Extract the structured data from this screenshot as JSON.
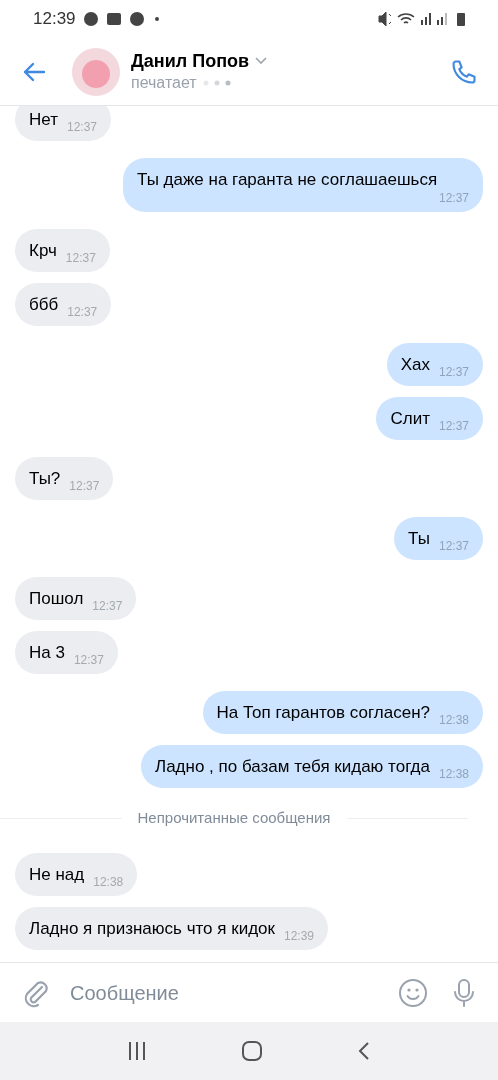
{
  "status_bar": {
    "time": "12:39"
  },
  "header": {
    "name": "Данил Попов",
    "status": "печатает"
  },
  "messages": [
    {
      "kind": "incoming",
      "text": "Нет",
      "time": "12:37"
    },
    {
      "kind": "outgoing",
      "text": "Ты даже на гаранта не соглашаешься",
      "time": "12:37"
    },
    {
      "kind": "incoming",
      "text": "Крч",
      "time": "12:37"
    },
    {
      "kind": "incoming",
      "text": "ббб",
      "time": "12:37"
    },
    {
      "kind": "outgoing",
      "text": "Хах",
      "time": "12:37"
    },
    {
      "kind": "outgoing",
      "text": "Слит",
      "time": "12:37"
    },
    {
      "kind": "incoming",
      "text": "Ты?",
      "time": "12:37"
    },
    {
      "kind": "outgoing",
      "text": "Ты",
      "time": "12:37"
    },
    {
      "kind": "incoming",
      "text": "Пошол",
      "time": "12:37"
    },
    {
      "kind": "incoming",
      "text": "На 3",
      "time": "12:37"
    },
    {
      "kind": "outgoing",
      "text": "На Топ гарантов согласен?",
      "time": "12:38"
    },
    {
      "kind": "outgoing",
      "text": "Ладно , по базам тебя кидаю тогда",
      "time": "12:38"
    },
    {
      "kind": "separator",
      "text": "Непрочитанные сообщения"
    },
    {
      "kind": "incoming",
      "text": "Не над",
      "time": "12:38"
    },
    {
      "kind": "incoming",
      "text": "Ладно я признаюсь что я кидок",
      "time": "12:39"
    }
  ],
  "composer": {
    "placeholder": "Сообщение"
  }
}
